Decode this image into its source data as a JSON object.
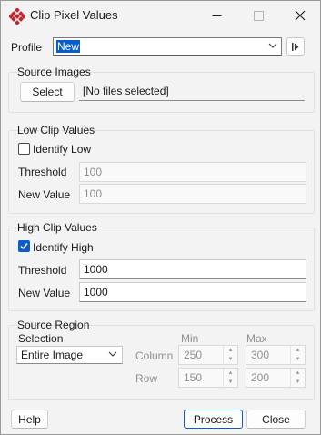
{
  "window": {
    "title": "Clip Pixel Values"
  },
  "profile": {
    "label": "Profile",
    "value": "New"
  },
  "source_images": {
    "title": "Source Images",
    "select_label": "Select",
    "files_text": "[No files selected]"
  },
  "low_clip": {
    "title": "Low Clip Values",
    "identify_label": "Identify Low",
    "identify_checked": false,
    "threshold_label": "Threshold",
    "threshold_value": "100",
    "new_value_label": "New Value",
    "new_value_value": "100"
  },
  "high_clip": {
    "title": "High Clip Values",
    "identify_label": "Identify High",
    "identify_checked": true,
    "threshold_label": "Threshold",
    "threshold_value": "1000",
    "new_value_label": "New Value",
    "new_value_value": "1000"
  },
  "source_region": {
    "title": "Source Region",
    "selection_label": "Selection",
    "selection_value": "Entire Image",
    "min_label": "Min",
    "max_label": "Max",
    "column_label": "Column",
    "row_label": "Row",
    "column_min": "250",
    "column_max": "300",
    "row_min": "150",
    "row_max": "200"
  },
  "buttons": {
    "help": "Help",
    "process": "Process",
    "close": "Close"
  },
  "colors": {
    "accent": "#0a5dc8",
    "app_icon": "#c0262d"
  },
  "icons": {
    "app": "grid-app-icon",
    "minimize": "minimize-icon",
    "maximize": "maximize-icon",
    "close": "close-icon",
    "dropdown": "chevron-down-icon",
    "profile_action": "play-bar-icon",
    "check": "checkmark-icon",
    "spin_up": "spin-up-icon",
    "spin_down": "spin-down-icon"
  }
}
